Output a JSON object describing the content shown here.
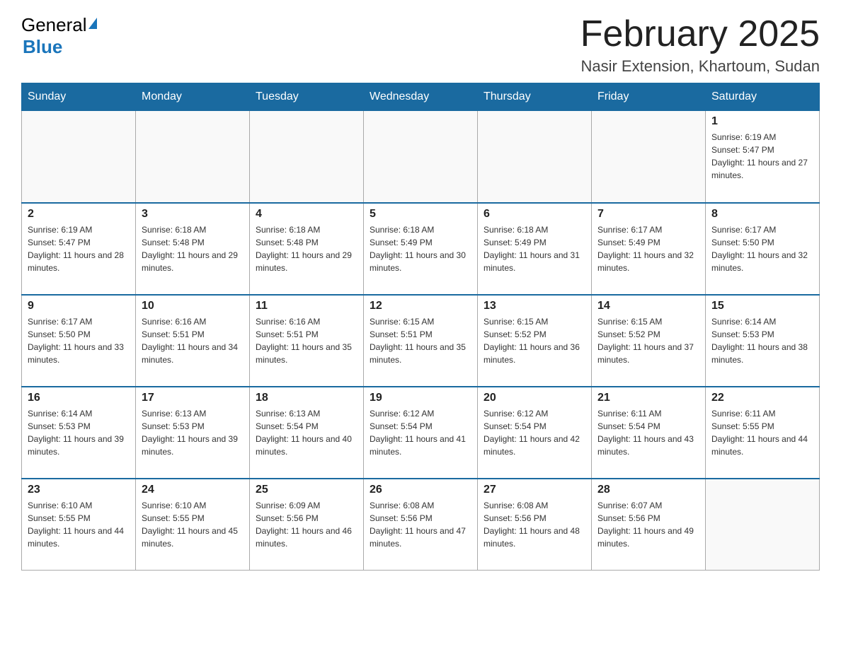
{
  "header": {
    "logo_general": "General",
    "logo_blue": "Blue",
    "title": "February 2025",
    "location": "Nasir Extension, Khartoum, Sudan"
  },
  "days_of_week": [
    "Sunday",
    "Monday",
    "Tuesday",
    "Wednesday",
    "Thursday",
    "Friday",
    "Saturday"
  ],
  "weeks": [
    {
      "days": [
        {
          "number": "",
          "info": ""
        },
        {
          "number": "",
          "info": ""
        },
        {
          "number": "",
          "info": ""
        },
        {
          "number": "",
          "info": ""
        },
        {
          "number": "",
          "info": ""
        },
        {
          "number": "",
          "info": ""
        },
        {
          "number": "1",
          "info": "Sunrise: 6:19 AM\nSunset: 5:47 PM\nDaylight: 11 hours and 27 minutes."
        }
      ]
    },
    {
      "days": [
        {
          "number": "2",
          "info": "Sunrise: 6:19 AM\nSunset: 5:47 PM\nDaylight: 11 hours and 28 minutes."
        },
        {
          "number": "3",
          "info": "Sunrise: 6:18 AM\nSunset: 5:48 PM\nDaylight: 11 hours and 29 minutes."
        },
        {
          "number": "4",
          "info": "Sunrise: 6:18 AM\nSunset: 5:48 PM\nDaylight: 11 hours and 29 minutes."
        },
        {
          "number": "5",
          "info": "Sunrise: 6:18 AM\nSunset: 5:49 PM\nDaylight: 11 hours and 30 minutes."
        },
        {
          "number": "6",
          "info": "Sunrise: 6:18 AM\nSunset: 5:49 PM\nDaylight: 11 hours and 31 minutes."
        },
        {
          "number": "7",
          "info": "Sunrise: 6:17 AM\nSunset: 5:49 PM\nDaylight: 11 hours and 32 minutes."
        },
        {
          "number": "8",
          "info": "Sunrise: 6:17 AM\nSunset: 5:50 PM\nDaylight: 11 hours and 32 minutes."
        }
      ]
    },
    {
      "days": [
        {
          "number": "9",
          "info": "Sunrise: 6:17 AM\nSunset: 5:50 PM\nDaylight: 11 hours and 33 minutes."
        },
        {
          "number": "10",
          "info": "Sunrise: 6:16 AM\nSunset: 5:51 PM\nDaylight: 11 hours and 34 minutes."
        },
        {
          "number": "11",
          "info": "Sunrise: 6:16 AM\nSunset: 5:51 PM\nDaylight: 11 hours and 35 minutes."
        },
        {
          "number": "12",
          "info": "Sunrise: 6:15 AM\nSunset: 5:51 PM\nDaylight: 11 hours and 35 minutes."
        },
        {
          "number": "13",
          "info": "Sunrise: 6:15 AM\nSunset: 5:52 PM\nDaylight: 11 hours and 36 minutes."
        },
        {
          "number": "14",
          "info": "Sunrise: 6:15 AM\nSunset: 5:52 PM\nDaylight: 11 hours and 37 minutes."
        },
        {
          "number": "15",
          "info": "Sunrise: 6:14 AM\nSunset: 5:53 PM\nDaylight: 11 hours and 38 minutes."
        }
      ]
    },
    {
      "days": [
        {
          "number": "16",
          "info": "Sunrise: 6:14 AM\nSunset: 5:53 PM\nDaylight: 11 hours and 39 minutes."
        },
        {
          "number": "17",
          "info": "Sunrise: 6:13 AM\nSunset: 5:53 PM\nDaylight: 11 hours and 39 minutes."
        },
        {
          "number": "18",
          "info": "Sunrise: 6:13 AM\nSunset: 5:54 PM\nDaylight: 11 hours and 40 minutes."
        },
        {
          "number": "19",
          "info": "Sunrise: 6:12 AM\nSunset: 5:54 PM\nDaylight: 11 hours and 41 minutes."
        },
        {
          "number": "20",
          "info": "Sunrise: 6:12 AM\nSunset: 5:54 PM\nDaylight: 11 hours and 42 minutes."
        },
        {
          "number": "21",
          "info": "Sunrise: 6:11 AM\nSunset: 5:54 PM\nDaylight: 11 hours and 43 minutes."
        },
        {
          "number": "22",
          "info": "Sunrise: 6:11 AM\nSunset: 5:55 PM\nDaylight: 11 hours and 44 minutes."
        }
      ]
    },
    {
      "days": [
        {
          "number": "23",
          "info": "Sunrise: 6:10 AM\nSunset: 5:55 PM\nDaylight: 11 hours and 44 minutes."
        },
        {
          "number": "24",
          "info": "Sunrise: 6:10 AM\nSunset: 5:55 PM\nDaylight: 11 hours and 45 minutes."
        },
        {
          "number": "25",
          "info": "Sunrise: 6:09 AM\nSunset: 5:56 PM\nDaylight: 11 hours and 46 minutes."
        },
        {
          "number": "26",
          "info": "Sunrise: 6:08 AM\nSunset: 5:56 PM\nDaylight: 11 hours and 47 minutes."
        },
        {
          "number": "27",
          "info": "Sunrise: 6:08 AM\nSunset: 5:56 PM\nDaylight: 11 hours and 48 minutes."
        },
        {
          "number": "28",
          "info": "Sunrise: 6:07 AM\nSunset: 5:56 PM\nDaylight: 11 hours and 49 minutes."
        },
        {
          "number": "",
          "info": ""
        }
      ]
    }
  ]
}
